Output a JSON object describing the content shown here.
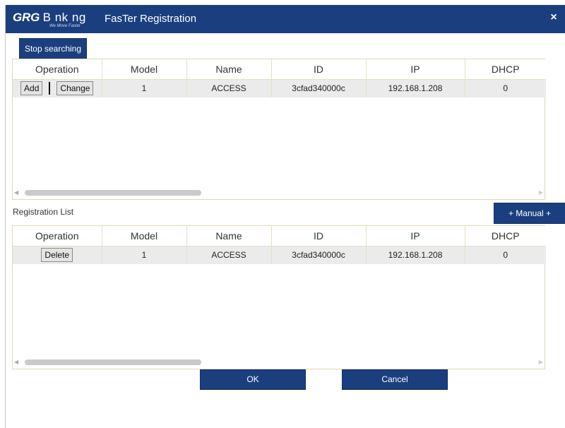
{
  "titlebar": {
    "logo_primary": "GRG",
    "logo_secondary": "B  nk ng",
    "logo_tagline": "We Move Faster",
    "title": "FasTer Registration",
    "close_symbol": "×"
  },
  "toolbar": {
    "stop_label": "Stop searching"
  },
  "columns": [
    "Operation",
    "Model",
    "Name",
    "ID",
    "IP",
    "DHCP"
  ],
  "search_results": {
    "rows": [
      {
        "ops": [
          "Add",
          "Change"
        ],
        "model": "1",
        "name": "ACCESS",
        "id": "3cfad340000c",
        "ip": "192.168.1.208",
        "dhcp": "0"
      }
    ]
  },
  "registration": {
    "label": "Registration List",
    "manual_label": "+ Manual +",
    "rows": [
      {
        "ops": [
          "Delete"
        ],
        "model": "1",
        "name": "ACCESS",
        "id": "3cfad340000c",
        "ip": "192.168.1.208",
        "dhcp": "0"
      }
    ]
  },
  "scrollbar": {
    "left_arrow": "◀",
    "right_arrow": "▶"
  },
  "footer": {
    "ok_label": "OK",
    "cancel_label": "Cancel"
  },
  "colors": {
    "brand": "#1b3f7e",
    "row_bg": "#ebebeb",
    "grid_border": "#e1d7b7"
  }
}
